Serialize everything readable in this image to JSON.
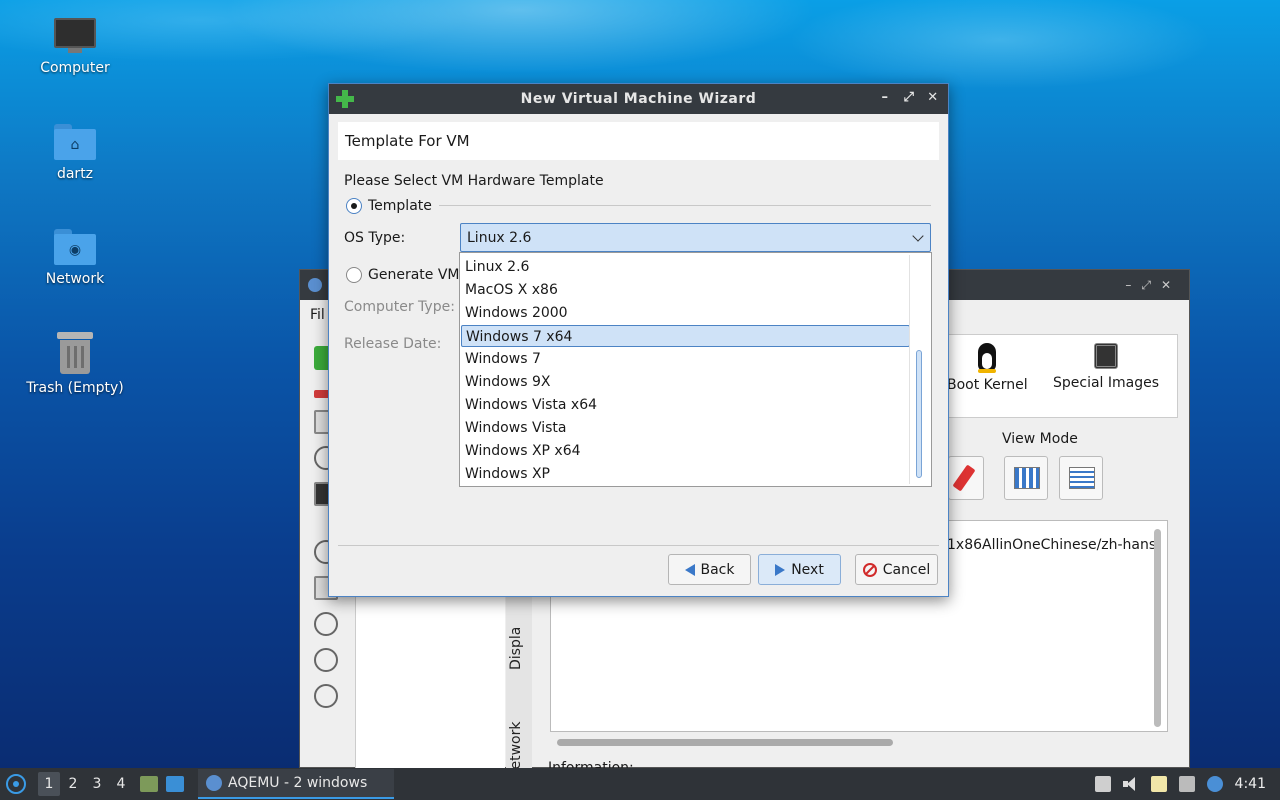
{
  "desktop": {
    "icons": [
      {
        "label": "Computer"
      },
      {
        "label": "dartz"
      },
      {
        "label": "Network"
      },
      {
        "label": "Trash (Empty)"
      }
    ]
  },
  "background_window": {
    "menu_partial": "Fil",
    "tool_icons": [
      "add-icon",
      "remove-icon",
      "drive-icon",
      "clock-icon",
      "terminal-icon",
      "play-icon",
      "save-icon",
      "pause-icon",
      "stop-icon",
      "reload-icon"
    ],
    "side_tabs": [
      "Displa",
      "Network"
    ],
    "icon_items": [
      {
        "label": "Boot Kernel",
        "icon": "tux-icon"
      },
      {
        "label": "Special Images",
        "icon": "chip-icon"
      }
    ],
    "view_mode_label": "View Mode",
    "info_path": "1x86AllinOneChinese/zh-hans",
    "information_label": "Information:"
  },
  "dialog": {
    "title": "New Virtual Machine Wizard",
    "header": "Template For VM",
    "prompt": "Please Select VM Hardware Template",
    "template_option": "Template",
    "os_type_label": "OS Type:",
    "os_type_value": "Linux 2.6",
    "generate_option": "Generate VM",
    "computer_type_label": "Computer Type:",
    "release_date_label": "Release Date:",
    "os_options": [
      "Linux 2.6",
      "MacOS X x86",
      "Windows 2000",
      "Windows 7 x64",
      "Windows 7",
      "Windows 9X",
      "Windows Vista x64",
      "Windows Vista",
      "Windows XP x64",
      "Windows XP"
    ],
    "highlighted_option": "Windows 7 x64",
    "buttons": {
      "back": "Back",
      "next": "Next",
      "cancel": "Cancel"
    }
  },
  "taskbar": {
    "workspaces": [
      "1",
      "2",
      "3",
      "4"
    ],
    "active_workspace": "1",
    "task_label": "AQEMU - 2 windows",
    "clock": "4:41"
  },
  "colors": {
    "accent": "#4c83c4",
    "selection": "#cfe2f7",
    "titlebar": "#353a40"
  }
}
